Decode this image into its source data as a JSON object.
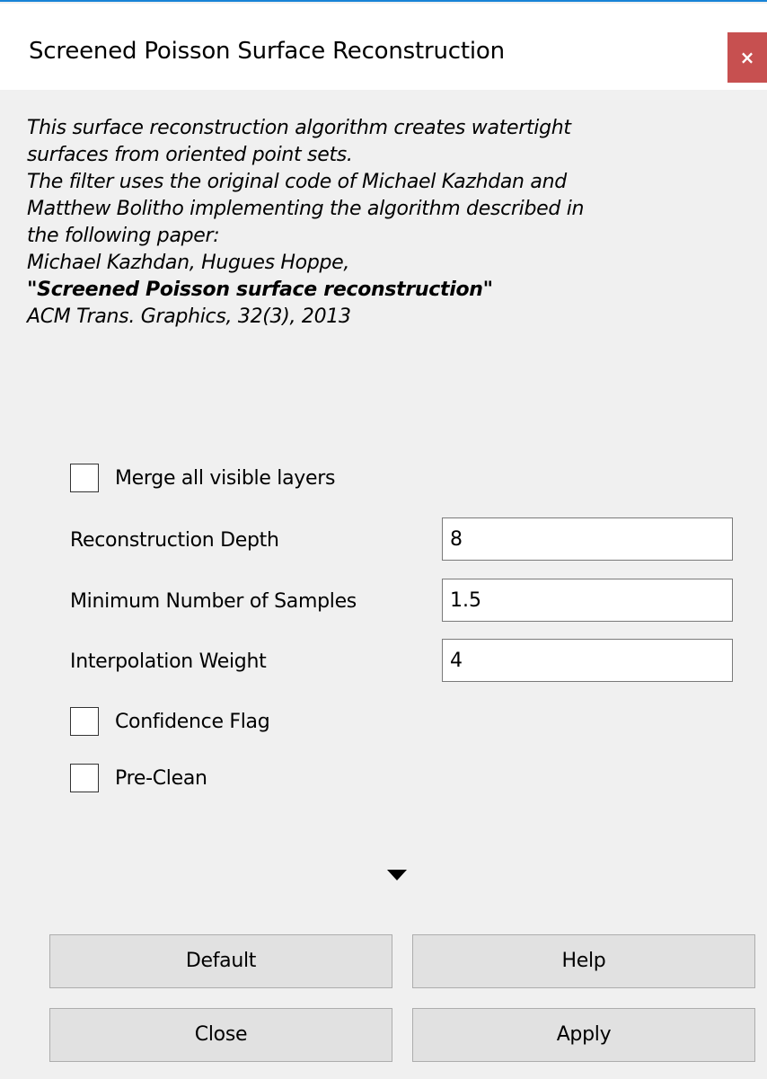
{
  "window": {
    "title": "Screened Poisson Surface Reconstruction",
    "close_glyph": "×"
  },
  "description": {
    "lines": [
      "This surface reconstruction algorithm creates watertight",
      "surfaces from oriented point sets.",
      "The filter uses the original code of Michael Kazhdan and",
      "Matthew Bolitho implementing the algorithm described in",
      "the following paper:",
      "Michael Kazhdan, Hugues Hoppe,"
    ],
    "paper_title": "\"Screened Poisson surface reconstruction\"",
    "citation": "ACM Trans. Graphics, 32(3), 2013"
  },
  "params": {
    "merge_layers": {
      "label": "Merge all visible layers",
      "checked": false
    },
    "depth": {
      "label": "Reconstruction Depth",
      "value": "8"
    },
    "min_samples": {
      "label": "Minimum Number of Samples",
      "value": "1.5"
    },
    "interp_weight": {
      "label": "Interpolation Weight",
      "value": "4"
    },
    "confidence": {
      "label": "Confidence Flag",
      "checked": false
    },
    "preclean": {
      "label": "Pre-Clean",
      "checked": false
    }
  },
  "buttons": {
    "default": "Default",
    "help": "Help",
    "close": "Close",
    "apply": "Apply"
  },
  "icons": {
    "close": "close-icon",
    "expand": "expand-arrow-icon"
  },
  "colors": {
    "title_accent": "#1883d7",
    "close_bg": "#c75050",
    "dialog_bg": "#f0f0f0",
    "button_bg": "#e1e1e1"
  }
}
